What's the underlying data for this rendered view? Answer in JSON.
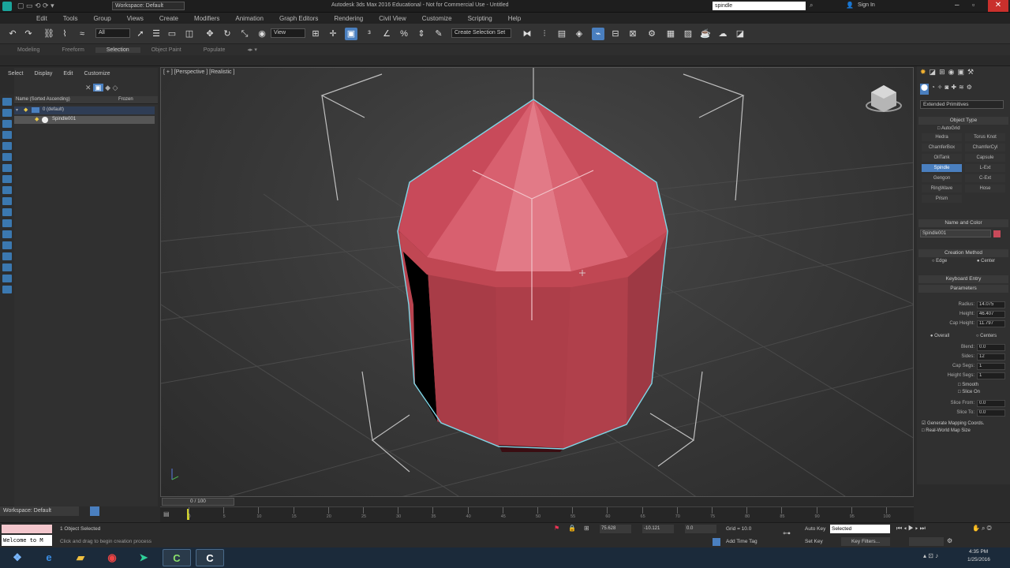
{
  "window": {
    "title": "Autodesk 3ds Max 2016 Educational - Not for Commercial Use - Untitled",
    "workspace": "Workspace: Default",
    "search": "spindle",
    "signin": "Sign In"
  },
  "menu": [
    "Edit",
    "Tools",
    "Group",
    "Views",
    "Create",
    "Modifiers",
    "Animation",
    "Graph Editors",
    "Rendering",
    "Civil View",
    "Customize",
    "Scripting",
    "Help"
  ],
  "toolbar": {
    "filter": "All",
    "refcoord": "View",
    "selection_set": "Create Selection Set"
  },
  "ribbon": {
    "tabs": [
      "Modeling",
      "Freeform",
      "Selection",
      "Object Paint",
      "Populate"
    ],
    "active": "Selection"
  },
  "scene_explorer": {
    "tabs": [
      "Select",
      "Display",
      "Edit",
      "Customize"
    ],
    "col_name": "Name (Sorted Ascending)",
    "col_frozen": "Frozen",
    "layer": "0 (default)",
    "object": "Spindle001",
    "workspace_bottom": "Workspace: Default"
  },
  "viewport": {
    "label": "[ + ] [Perspective ] [Realistic ]"
  },
  "command_panel": {
    "category": "Extended Primitives",
    "object_type_title": "Object Type",
    "autogrid": "AutoGrid",
    "buttons": [
      [
        "Hedra",
        "Torus Knot"
      ],
      [
        "ChamferBox",
        "ChamferCyl"
      ],
      [
        "OilTank",
        "Capsule"
      ],
      [
        "Spindle",
        "L-Ext"
      ],
      [
        "Gengon",
        "C-Ext"
      ],
      [
        "RingWave",
        "Hose"
      ],
      [
        "Prism",
        ""
      ]
    ],
    "active_button": "Spindle",
    "name_color_title": "Name and Color",
    "object_name": "Spindle001",
    "object_color": "#c84a5a",
    "creation_method_title": "Creation Method",
    "creation_edge": "Edge",
    "creation_center": "Center",
    "keyboard_entry_title": "Keyboard Entry",
    "parameters_title": "Parameters",
    "params": [
      {
        "label": "Radius:",
        "value": "14.075"
      },
      {
        "label": "Height:",
        "value": "46.407"
      },
      {
        "label": "Cap Height:",
        "value": "11.797"
      }
    ],
    "blend_mode_overall": "Overall",
    "blend_mode_centers": "Centers",
    "params2": [
      {
        "label": "Blend:",
        "value": "0.0"
      },
      {
        "label": "Sides:",
        "value": "12"
      },
      {
        "label": "Cap Segs:",
        "value": "1"
      },
      {
        "label": "Height Segs:",
        "value": "1"
      }
    ],
    "smooth": "Smooth",
    "slice_on": "Slice On",
    "slice_from_label": "Slice From:",
    "slice_from": "0.0",
    "slice_to_label": "Slice To:",
    "slice_to": "0.0",
    "gen_mapping": "Generate Mapping Coords.",
    "real_world": "Real-World Map Size"
  },
  "timeline": {
    "frame": "0 / 100",
    "ticks": [
      "0",
      "5",
      "10",
      "15",
      "20",
      "25",
      "30",
      "35",
      "40",
      "45",
      "50",
      "55",
      "60",
      "65",
      "70",
      "75",
      "80",
      "85",
      "90",
      "95",
      "100"
    ]
  },
  "status": {
    "selected": "1 Object Selected",
    "prompt": "Click and drag to begin creation process",
    "maxscript": "Welcome to M",
    "x": "75.628",
    "y": "-10.121",
    "z": "0.0",
    "grid": "Grid = 10.0",
    "add_time_tag": "Add Time Tag",
    "autokey": "Auto Key",
    "setkey": "Set Key",
    "selected_dd": "Selected",
    "key_filters": "Key Filters..."
  },
  "taskbar": {
    "time": "4:35 PM",
    "date": "1/25/2016"
  }
}
